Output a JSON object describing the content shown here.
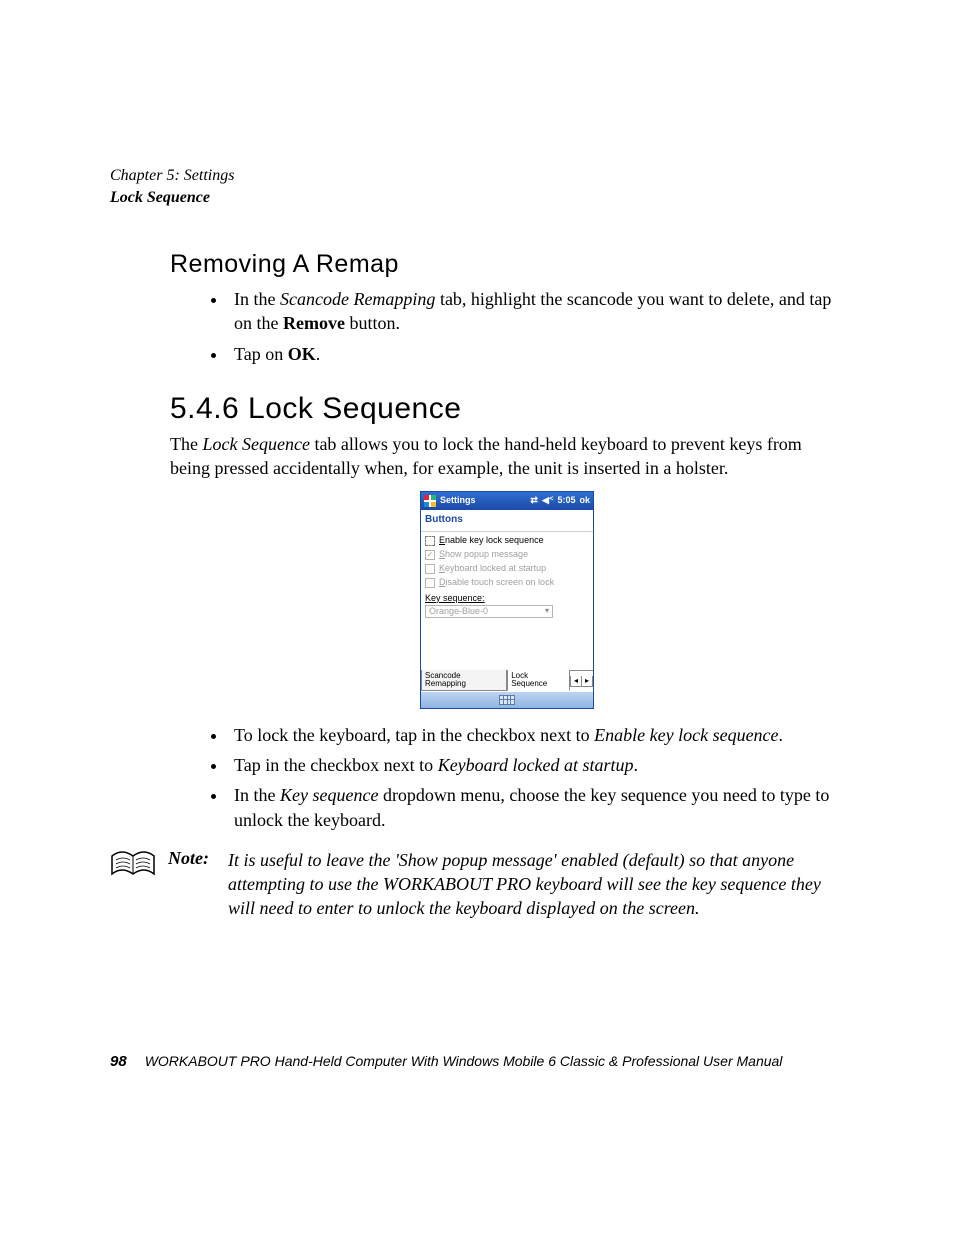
{
  "running_head": {
    "chapter": "Chapter 5: Settings",
    "section": "Lock Sequence"
  },
  "subhead1": "Removing A Remap",
  "list1": {
    "item1_pre": "In the ",
    "item1_em": "Scancode Remapping",
    "item1_mid": " tab, highlight the scancode you want to delete, and tap on the ",
    "item1_bold": "Remove",
    "item1_post": " button.",
    "item2_pre": "Tap on ",
    "item2_bold": "OK",
    "item2_post": "."
  },
  "section_head": "5.4.6  Lock Sequence",
  "para1_pre": "The ",
  "para1_em": "Lock Sequence",
  "para1_post": " tab allows you to lock the hand-held keyboard to prevent keys from being pressed accidentally when, for example, the unit is inserted in a holster.",
  "device": {
    "title": "Settings",
    "time": "5:05",
    "ok": "ok",
    "subtitle": "Buttons",
    "chk1": "Enable key lock sequence",
    "chk2": "Show popup message",
    "chk3": "Keyboard locked at startup",
    "chk4": "Disable touch screen on lock",
    "keyseq_label": "Key sequence:",
    "keyseq_value": "Orange-Blue-0",
    "tab1": "Scancode Remapping",
    "tab2": "Lock Sequence"
  },
  "list2": {
    "item1_pre": "To lock the keyboard, tap in the checkbox next to ",
    "item1_em": "Enable key lock sequence",
    "item1_post": ".",
    "item2_pre": "Tap in the checkbox next to ",
    "item2_em": "Keyboard locked at startup",
    "item2_post": ".",
    "item3_pre": "In the ",
    "item3_em": "Key sequence",
    "item3_post": " dropdown menu, choose the key sequence you need to type to unlock the keyboard."
  },
  "note": {
    "label": "Note:",
    "text": "It is useful to leave the 'Show popup message' enabled (default) so that anyone attempting to use the WORKABOUT PRO keyboard will see the key sequence they will need to enter to unlock the keyboard displayed on the screen."
  },
  "footer": {
    "page": "98",
    "title": "WORKABOUT PRO Hand-Held Computer With Windows Mobile 6 Classic & Professional User Manual"
  }
}
